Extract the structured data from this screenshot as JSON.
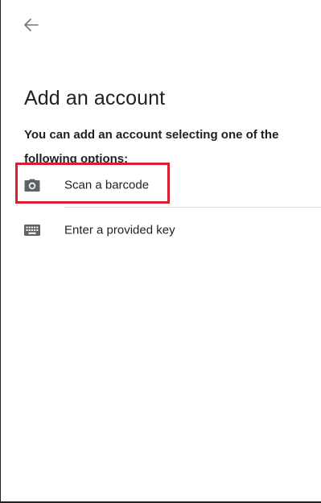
{
  "header": {
    "back_icon": "arrow-left-icon"
  },
  "page": {
    "title": "Add an account",
    "subtitle": "You can add an account selecting one of the following options:"
  },
  "options": [
    {
      "label": "Scan a barcode",
      "icon": "camera-icon"
    },
    {
      "label": "Enter a provided key",
      "icon": "keyboard-icon"
    }
  ],
  "colors": {
    "text": "#202124",
    "icon": "#5f6368",
    "divider": "#e0e0e0",
    "highlight": "#d6202f"
  }
}
